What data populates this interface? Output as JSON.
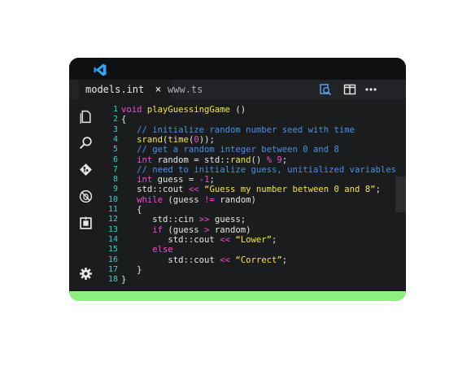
{
  "tabs": [
    {
      "label": "models.int",
      "close": "×"
    },
    {
      "label": "www.ts"
    }
  ],
  "icons": {
    "app": "vscode-icon",
    "toolbar": [
      "search-file-icon",
      "split-editor-icon",
      "more-icon"
    ],
    "sidebar": [
      "files-icon",
      "search-icon",
      "git-icon",
      "no-bug-icon",
      "extensions-icon",
      "gear-icon"
    ]
  },
  "colors": {
    "background": "#1b1c1e",
    "line_numbers": "#3dd0c8",
    "keyword": "#f04bd5",
    "function": "#f4e34f",
    "comment": "#4a8fe6",
    "footer": "#8ef07f"
  },
  "code": {
    "lines": [
      {
        "num": "1",
        "t": [
          [
            "kw",
            "void "
          ],
          [
            "fn",
            "playGuessingGame "
          ],
          [
            "pl",
            "()"
          ]
        ]
      },
      {
        "num": "2",
        "t": [
          [
            "pl",
            "{"
          ]
        ]
      },
      {
        "num": "3",
        "t": [
          [
            "pl",
            "   "
          ],
          [
            "cm",
            "// initialize random number seed with time"
          ]
        ]
      },
      {
        "num": "4",
        "t": [
          [
            "pl",
            "   "
          ],
          [
            "fn",
            "srand"
          ],
          [
            "pl",
            "("
          ],
          [
            "fn",
            "time"
          ],
          [
            "pl",
            "("
          ],
          [
            "num",
            "0"
          ],
          [
            "pl",
            "));"
          ]
        ]
      },
      {
        "num": "5",
        "t": [
          [
            "pl",
            "   "
          ],
          [
            "cm",
            "// get a random integer between 0 and 8"
          ]
        ]
      },
      {
        "num": "6",
        "t": [
          [
            "pl",
            "   "
          ],
          [
            "kw",
            "int "
          ],
          [
            "pl",
            "random = std::"
          ],
          [
            "fn",
            "rand"
          ],
          [
            "pl",
            "() "
          ],
          [
            "op",
            "%"
          ],
          [
            "pl",
            " "
          ],
          [
            "num",
            "9"
          ],
          [
            "pl",
            ";"
          ]
        ]
      },
      {
        "num": "7",
        "t": [
          [
            "pl",
            "   "
          ],
          [
            "cm",
            "// need to initialize guess, unitialized variables"
          ]
        ]
      },
      {
        "num": "8",
        "t": [
          [
            "pl",
            "   "
          ],
          [
            "kw",
            "int "
          ],
          [
            "pl",
            "guess = "
          ],
          [
            "op",
            "-1"
          ],
          [
            "pl",
            ";"
          ]
        ]
      },
      {
        "num": "9",
        "t": [
          [
            "pl",
            "   std::cout "
          ],
          [
            "op",
            "<<"
          ],
          [
            "pl",
            " "
          ],
          [
            "str",
            "“Guess my number between 0 and 8”"
          ],
          [
            "pl",
            ";"
          ]
        ]
      },
      {
        "num": "10",
        "t": [
          [
            "pl",
            "   "
          ],
          [
            "kw",
            "while "
          ],
          [
            "pl",
            "(guess "
          ],
          [
            "op",
            "!="
          ],
          [
            "pl",
            " random)"
          ]
        ]
      },
      {
        "num": "11",
        "t": [
          [
            "pl",
            "   {"
          ]
        ]
      },
      {
        "num": "12",
        "t": [
          [
            "pl",
            "      std::cin "
          ],
          [
            "op",
            ">>"
          ],
          [
            "pl",
            " guess;"
          ]
        ]
      },
      {
        "num": "13",
        "t": [
          [
            "pl",
            "      "
          ],
          [
            "kw",
            "if "
          ],
          [
            "pl",
            "(guess "
          ],
          [
            "op",
            ">"
          ],
          [
            "pl",
            " random)"
          ]
        ]
      },
      {
        "num": "14",
        "t": [
          [
            "pl",
            "         std::cout "
          ],
          [
            "op",
            "<<"
          ],
          [
            "pl",
            " "
          ],
          [
            "str",
            "“Lower”"
          ],
          [
            "pl",
            ";"
          ]
        ]
      },
      {
        "num": "15",
        "t": [
          [
            "pl",
            "      "
          ],
          [
            "kw",
            "else"
          ]
        ]
      },
      {
        "num": "16",
        "t": [
          [
            "pl",
            "         std::cout "
          ],
          [
            "op",
            "<<"
          ],
          [
            "pl",
            " "
          ],
          [
            "str",
            "“Correct”"
          ],
          [
            "pl",
            ";"
          ]
        ]
      },
      {
        "num": "17",
        "t": [
          [
            "pl",
            "   }"
          ]
        ]
      },
      {
        "num": "18",
        "t": [
          [
            "pl",
            "}"
          ]
        ]
      }
    ]
  }
}
